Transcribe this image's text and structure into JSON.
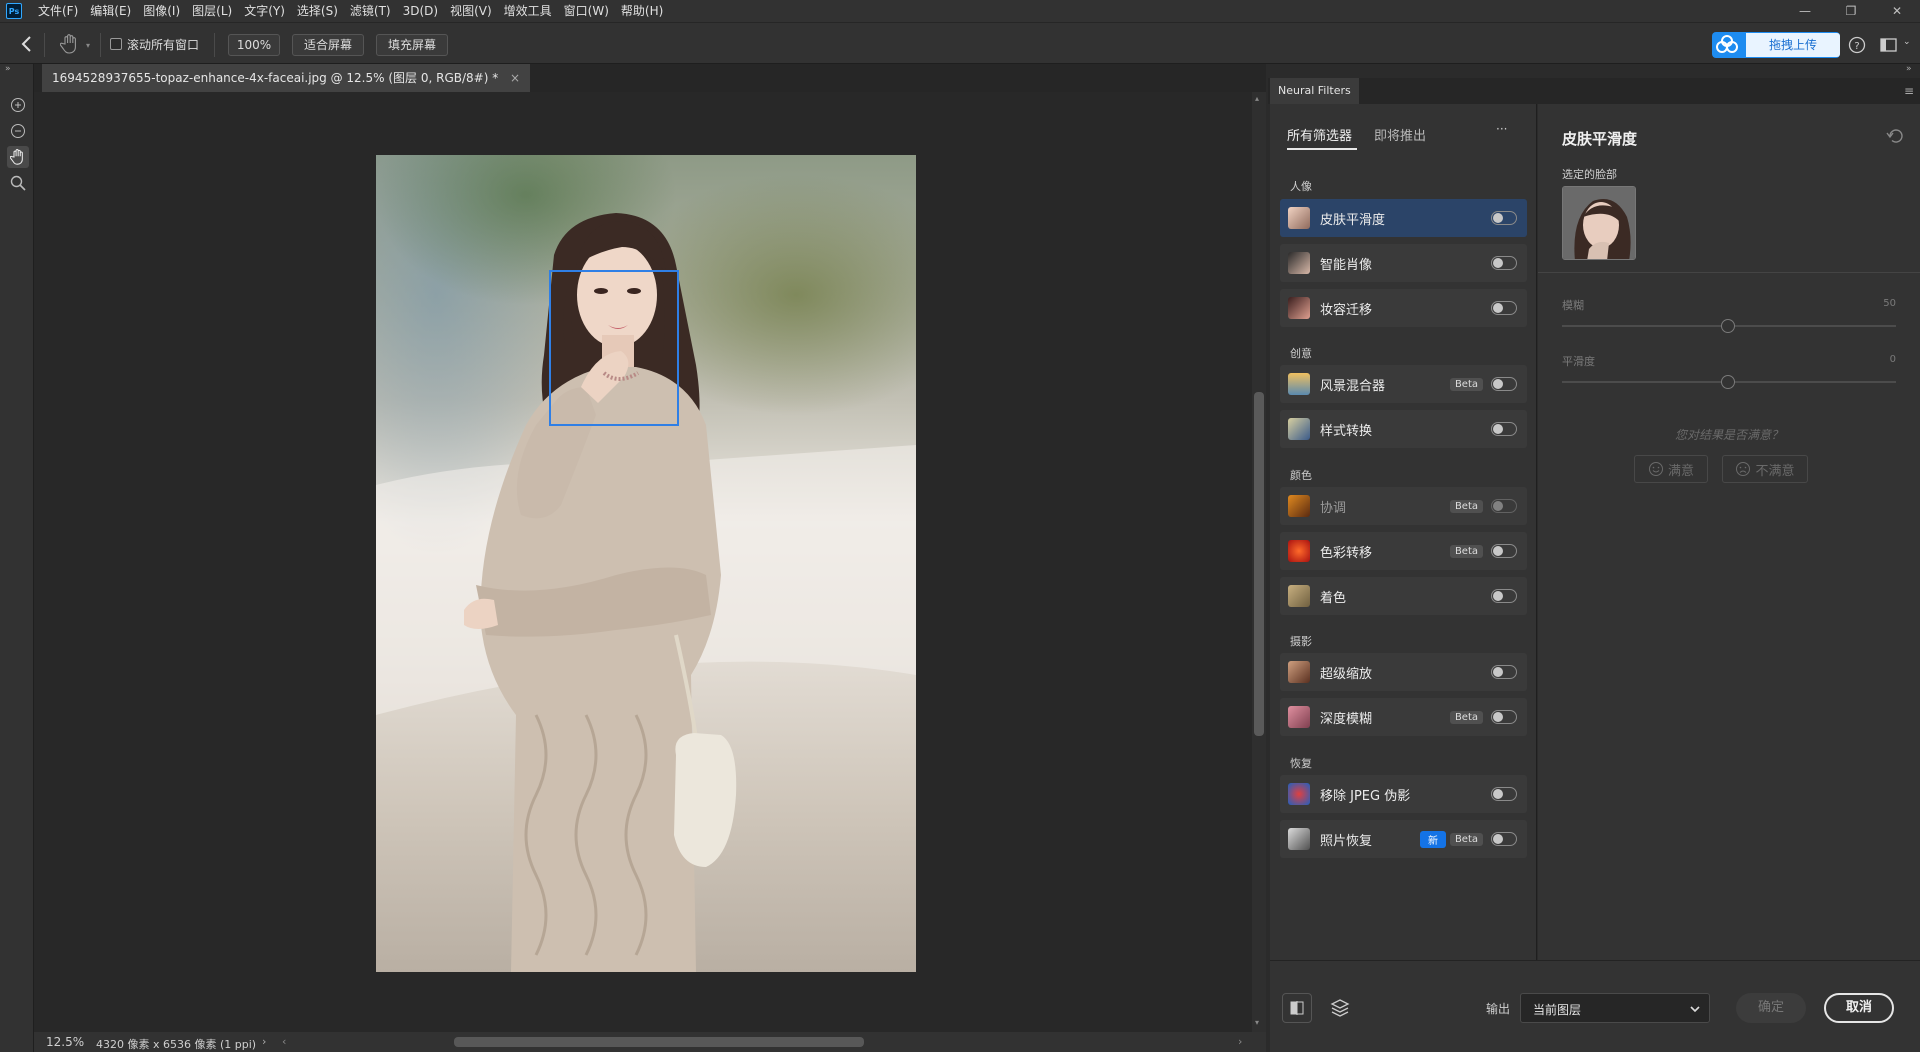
{
  "menu": {
    "logo": "Ps",
    "items": [
      "文件(F)",
      "编辑(E)",
      "图像(I)",
      "图层(L)",
      "文字(Y)",
      "选择(S)",
      "滤镜(T)",
      "3D(D)",
      "视图(V)",
      "增效工具",
      "窗口(W)",
      "帮助(H)"
    ]
  },
  "options": {
    "scroll_all_label": "滚动所有窗口",
    "zoom_value": "100%",
    "fit_screen": "适合屏幕",
    "fill_screen": "填充屏幕",
    "upload_label": "拖拽上传"
  },
  "document": {
    "tab_title": "1694528937655-topaz-enhance-4x-faceai.jpg @ 12.5% (图层 0, RGB/8#) *",
    "status_zoom": "12.5%",
    "status_info": "4320 像素 x 6536 像素 (1 ppi)"
  },
  "neural": {
    "panel_tab": "Neural Filters",
    "tab_all": "所有筛选器",
    "tab_coming": "即将推出",
    "more": "···",
    "categories": {
      "portrait": "人像",
      "creative": "创意",
      "color": "颜色",
      "photography": "摄影",
      "restore": "恢复"
    },
    "filters": {
      "skin": "皮肤平滑度",
      "smart_portrait": "智能肖像",
      "makeup": "妆容迁移",
      "landscape": "风景混合器",
      "style": "样式转换",
      "harmonize": "协调",
      "color_transfer": "色彩转移",
      "colorize": "着色",
      "super_zoom": "超级缩放",
      "depth_blur": "深度模糊",
      "jpeg": "移除 JPEG 伪影",
      "photo_restore": "照片恢复"
    },
    "beta": "Beta",
    "new": "新"
  },
  "settings": {
    "title": "皮肤平滑度",
    "selected_face": "选定的脸部",
    "blur_label": "模糊",
    "blur_value": "50",
    "smooth_label": "平滑度",
    "smooth_value": "0",
    "feedback_question": "您对结果是否满意？",
    "satisfied": "满意",
    "unsatisfied": "不满意"
  },
  "bottom": {
    "output_label": "输出",
    "output_value": "当前图层",
    "ok": "确定",
    "cancel": "取消"
  },
  "colors": {
    "accent": "#1473e6",
    "selected_row": "#2b4468",
    "face_box": "#2f7fe6"
  }
}
